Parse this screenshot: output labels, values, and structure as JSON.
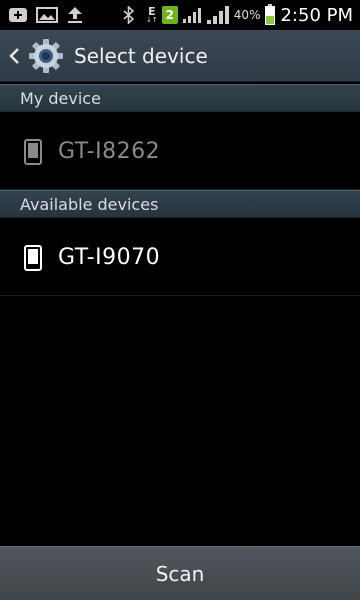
{
  "status_bar": {
    "notification_icons": [
      "add-icon",
      "image-icon",
      "upload-icon"
    ],
    "right_icons": [
      "bluetooth-icon",
      "data-edge-icon",
      "sim-badge",
      "signal-icon",
      "signal-icon",
      "battery-icon"
    ],
    "data_type_label_top": "E",
    "data_type_label_bottom": "↓↑",
    "sim_badge": "2",
    "battery_percent": "40%",
    "time": "2:50 PM"
  },
  "action_bar": {
    "title": "Select device",
    "app_icon": "settings-gear-icon",
    "back_icon": "chevron-left-icon"
  },
  "sections": {
    "my_device": {
      "header": "My device",
      "devices": [
        {
          "name": "GT-I8262",
          "icon": "phone-icon"
        }
      ]
    },
    "available_devices": {
      "header": "Available devices",
      "devices": [
        {
          "name": "GT-I9070",
          "icon": "phone-icon"
        }
      ]
    }
  },
  "footer": {
    "scan_label": "Scan"
  },
  "colors": {
    "action_bar": "#34424d",
    "section_header": "#2d3b46",
    "battery_fill": "#8cc63f",
    "sim_badge": "#6fb41e",
    "dim_text": "#8a8a8a"
  }
}
